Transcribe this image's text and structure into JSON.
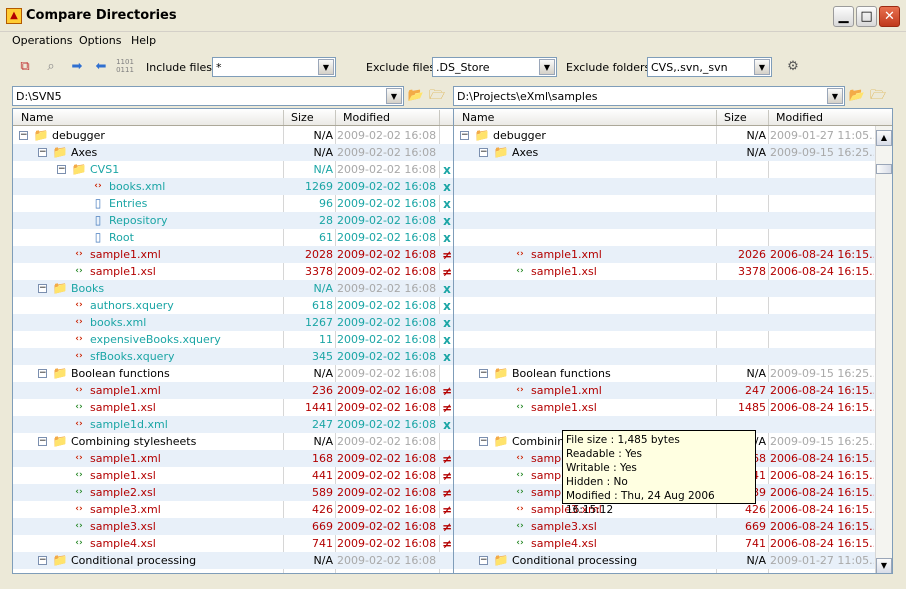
{
  "window": {
    "title": "Compare Directories"
  },
  "menu": [
    {
      "label": "Operations"
    },
    {
      "label": "Options"
    },
    {
      "label": "Help"
    }
  ],
  "toolbar": {
    "include_label": "Include files:",
    "include_value": "*",
    "exclude_files_label": "Exclude files:",
    "exclude_files_value": ".DS_Store",
    "exclude_folders_label": "Exclude folders:",
    "exclude_folders_value": "CVS,.svn,_svn"
  },
  "left_path": "D:\\SVN5",
  "right_path": "D:\\Projects\\eXml\\samples",
  "columns": {
    "name": "Name",
    "size": "Size",
    "modified": "Modified"
  },
  "left_rows": [
    {
      "exp": "−",
      "lvl": 0,
      "icon": "folder",
      "name": "debugger",
      "size": "N/A",
      "mod": "2009-02-02  16:08...",
      "nc": "black",
      "sc": "black",
      "mc": "gray",
      "mark": ""
    },
    {
      "exp": "−",
      "lvl": 1,
      "icon": "folder",
      "name": "Axes",
      "size": "N/A",
      "mod": "2009-02-02  16:08...",
      "nc": "black",
      "sc": "black",
      "mc": "gray",
      "mark": ""
    },
    {
      "exp": "−",
      "lvl": 2,
      "icon": "folder",
      "name": "CVS1",
      "size": "N/A",
      "mod": "2009-02-02  16:08...",
      "nc": "cyan",
      "sc": "cyan",
      "mc": "gray",
      "mark": "x"
    },
    {
      "exp": "",
      "lvl": 3,
      "icon": "xml",
      "name": "books.xml",
      "size": "1269",
      "mod": "2009-02-02  16:08...",
      "nc": "cyan",
      "sc": "cyan",
      "mc": "cyan",
      "mark": "x"
    },
    {
      "exp": "",
      "lvl": 3,
      "icon": "doc",
      "name": "Entries",
      "size": "96",
      "mod": "2009-02-02  16:08...",
      "nc": "cyan",
      "sc": "cyan",
      "mc": "cyan",
      "mark": "x"
    },
    {
      "exp": "",
      "lvl": 3,
      "icon": "doc",
      "name": "Repository",
      "size": "28",
      "mod": "2009-02-02  16:08...",
      "nc": "cyan",
      "sc": "cyan",
      "mc": "cyan",
      "mark": "x"
    },
    {
      "exp": "",
      "lvl": 3,
      "icon": "doc",
      "name": "Root",
      "size": "61",
      "mod": "2009-02-02  16:08...",
      "nc": "cyan",
      "sc": "cyan",
      "mc": "cyan",
      "mark": "x"
    },
    {
      "exp": "",
      "lvl": 2,
      "icon": "xml",
      "name": "sample1.xml",
      "size": "2028",
      "mod": "2009-02-02  16:08...",
      "nc": "red",
      "sc": "red",
      "mc": "red",
      "mark": "≠"
    },
    {
      "exp": "",
      "lvl": 2,
      "icon": "xsl",
      "name": "sample1.xsl",
      "size": "3378",
      "mod": "2009-02-02  16:08...",
      "nc": "red",
      "sc": "red",
      "mc": "red",
      "mark": "≠"
    },
    {
      "exp": "−",
      "lvl": 1,
      "icon": "folder",
      "name": "Books",
      "size": "N/A",
      "mod": "2009-02-02  16:08...",
      "nc": "cyan",
      "sc": "cyan",
      "mc": "gray",
      "mark": "x"
    },
    {
      "exp": "",
      "lvl": 2,
      "icon": "xml",
      "name": "authors.xquery",
      "size": "618",
      "mod": "2009-02-02  16:08...",
      "nc": "cyan",
      "sc": "cyan",
      "mc": "cyan",
      "mark": "x"
    },
    {
      "exp": "",
      "lvl": 2,
      "icon": "xml",
      "name": "books.xml",
      "size": "1267",
      "mod": "2009-02-02  16:08...",
      "nc": "cyan",
      "sc": "cyan",
      "mc": "cyan",
      "mark": "x"
    },
    {
      "exp": "",
      "lvl": 2,
      "icon": "xml",
      "name": "expensiveBooks.xquery",
      "size": "11",
      "mod": "2009-02-02  16:08...",
      "nc": "cyan",
      "sc": "cyan",
      "mc": "cyan",
      "mark": "x"
    },
    {
      "exp": "",
      "lvl": 2,
      "icon": "xml",
      "name": "sfBooks.xquery",
      "size": "345",
      "mod": "2009-02-02  16:08...",
      "nc": "cyan",
      "sc": "cyan",
      "mc": "cyan",
      "mark": "x"
    },
    {
      "exp": "−",
      "lvl": 1,
      "icon": "folder",
      "name": "Boolean functions",
      "size": "N/A",
      "mod": "2009-02-02  16:08...",
      "nc": "black",
      "sc": "black",
      "mc": "gray",
      "mark": ""
    },
    {
      "exp": "",
      "lvl": 2,
      "icon": "xml",
      "name": "sample1.xml",
      "size": "236",
      "mod": "2009-02-02  16:08...",
      "nc": "red",
      "sc": "red",
      "mc": "red",
      "mark": "≠"
    },
    {
      "exp": "",
      "lvl": 2,
      "icon": "xsl",
      "name": "sample1.xsl",
      "size": "1441",
      "mod": "2009-02-02  16:08...",
      "nc": "red",
      "sc": "red",
      "mc": "red",
      "mark": "≠"
    },
    {
      "exp": "",
      "lvl": 2,
      "icon": "xml",
      "name": "sample1d.xml",
      "size": "247",
      "mod": "2009-02-02  16:08...",
      "nc": "cyan",
      "sc": "cyan",
      "mc": "cyan",
      "mark": "x"
    },
    {
      "exp": "−",
      "lvl": 1,
      "icon": "folder",
      "name": "Combining stylesheets",
      "size": "N/A",
      "mod": "2009-02-02  16:08...",
      "nc": "black",
      "sc": "black",
      "mc": "gray",
      "mark": ""
    },
    {
      "exp": "",
      "lvl": 2,
      "icon": "xml",
      "name": "sample1.xml",
      "size": "168",
      "mod": "2009-02-02  16:08...",
      "nc": "red",
      "sc": "red",
      "mc": "red",
      "mark": "≠"
    },
    {
      "exp": "",
      "lvl": 2,
      "icon": "xsl",
      "name": "sample1.xsl",
      "size": "441",
      "mod": "2009-02-02  16:08...",
      "nc": "red",
      "sc": "red",
      "mc": "red",
      "mark": "≠"
    },
    {
      "exp": "",
      "lvl": 2,
      "icon": "xsl",
      "name": "sample2.xsl",
      "size": "589",
      "mod": "2009-02-02  16:08...",
      "nc": "red",
      "sc": "red",
      "mc": "red",
      "mark": "≠"
    },
    {
      "exp": "",
      "lvl": 2,
      "icon": "xml",
      "name": "sample3.xml",
      "size": "426",
      "mod": "2009-02-02  16:08...",
      "nc": "red",
      "sc": "red",
      "mc": "red",
      "mark": "≠"
    },
    {
      "exp": "",
      "lvl": 2,
      "icon": "xsl",
      "name": "sample3.xsl",
      "size": "669",
      "mod": "2009-02-02  16:08...",
      "nc": "red",
      "sc": "red",
      "mc": "red",
      "mark": "≠"
    },
    {
      "exp": "",
      "lvl": 2,
      "icon": "xsl",
      "name": "sample4.xsl",
      "size": "741",
      "mod": "2009-02-02  16:08...",
      "nc": "red",
      "sc": "red",
      "mc": "red",
      "mark": "≠"
    },
    {
      "exp": "−",
      "lvl": 1,
      "icon": "folder",
      "name": "Conditional processing",
      "size": "N/A",
      "mod": "2009-02-02  16:08...",
      "nc": "black",
      "sc": "black",
      "mc": "gray",
      "mark": ""
    }
  ],
  "right_rows": [
    {
      "exp": "−",
      "lvl": 0,
      "icon": "folder",
      "name": "debugger",
      "size": "N/A",
      "mod": "2009-01-27  11:05...",
      "nc": "black",
      "sc": "black",
      "mc": "gray"
    },
    {
      "exp": "−",
      "lvl": 1,
      "icon": "folder",
      "name": "Axes",
      "size": "N/A",
      "mod": "2009-09-15  16:25...",
      "nc": "black",
      "sc": "black",
      "mc": "gray"
    },
    {
      "exp": "",
      "lvl": 0,
      "icon": "",
      "name": "",
      "size": "",
      "mod": "",
      "nc": "black",
      "sc": "black",
      "mc": "gray"
    },
    {
      "exp": "",
      "lvl": 0,
      "icon": "",
      "name": "",
      "size": "",
      "mod": "",
      "nc": "black",
      "sc": "black",
      "mc": "gray"
    },
    {
      "exp": "",
      "lvl": 0,
      "icon": "",
      "name": "",
      "size": "",
      "mod": "",
      "nc": "black",
      "sc": "black",
      "mc": "gray"
    },
    {
      "exp": "",
      "lvl": 0,
      "icon": "",
      "name": "",
      "size": "",
      "mod": "",
      "nc": "black",
      "sc": "black",
      "mc": "gray"
    },
    {
      "exp": "",
      "lvl": 0,
      "icon": "",
      "name": "",
      "size": "",
      "mod": "",
      "nc": "black",
      "sc": "black",
      "mc": "gray"
    },
    {
      "exp": "",
      "lvl": 2,
      "icon": "xml",
      "name": "sample1.xml",
      "size": "2026",
      "mod": "2006-08-24  16:15...",
      "nc": "red",
      "sc": "red",
      "mc": "red"
    },
    {
      "exp": "",
      "lvl": 2,
      "icon": "xsl",
      "name": "sample1.xsl",
      "size": "3378",
      "mod": "2006-08-24  16:15...",
      "nc": "red",
      "sc": "red",
      "mc": "red"
    },
    {
      "exp": "",
      "lvl": 0,
      "icon": "",
      "name": "",
      "size": "",
      "mod": "",
      "nc": "black",
      "sc": "black",
      "mc": "gray"
    },
    {
      "exp": "",
      "lvl": 0,
      "icon": "",
      "name": "",
      "size": "",
      "mod": "",
      "nc": "black",
      "sc": "black",
      "mc": "gray"
    },
    {
      "exp": "",
      "lvl": 0,
      "icon": "",
      "name": "",
      "size": "",
      "mod": "",
      "nc": "black",
      "sc": "black",
      "mc": "gray"
    },
    {
      "exp": "",
      "lvl": 0,
      "icon": "",
      "name": "",
      "size": "",
      "mod": "",
      "nc": "black",
      "sc": "black",
      "mc": "gray"
    },
    {
      "exp": "",
      "lvl": 0,
      "icon": "",
      "name": "",
      "size": "",
      "mod": "",
      "nc": "black",
      "sc": "black",
      "mc": "gray"
    },
    {
      "exp": "−",
      "lvl": 1,
      "icon": "folder",
      "name": "Boolean functions",
      "size": "N/A",
      "mod": "2009-09-15  16:25...",
      "nc": "black",
      "sc": "black",
      "mc": "gray"
    },
    {
      "exp": "",
      "lvl": 2,
      "icon": "xml",
      "name": "sample1.xml",
      "size": "247",
      "mod": "2006-08-24  16:15...",
      "nc": "red",
      "sc": "red",
      "mc": "red"
    },
    {
      "exp": "",
      "lvl": 2,
      "icon": "xsl",
      "name": "sample1.xsl",
      "size": "1485",
      "mod": "2006-08-24  16:15...",
      "nc": "red",
      "sc": "red",
      "mc": "red"
    },
    {
      "exp": "",
      "lvl": 0,
      "icon": "",
      "name": "",
      "size": "",
      "mod": "",
      "nc": "black",
      "sc": "black",
      "mc": "gray"
    },
    {
      "exp": "−",
      "lvl": 1,
      "icon": "folder",
      "name": "Combining",
      "size": "N/A",
      "mod": "2009-09-15  16:25...",
      "nc": "black",
      "sc": "black",
      "mc": "gray"
    },
    {
      "exp": "",
      "lvl": 2,
      "icon": "xml",
      "name": "sample1.xml",
      "size": "168",
      "mod": "2006-08-24  16:15...",
      "nc": "red",
      "sc": "red",
      "mc": "red"
    },
    {
      "exp": "",
      "lvl": 2,
      "icon": "xsl",
      "name": "sample1.xsl",
      "size": "441",
      "mod": "2006-08-24  16:15...",
      "nc": "red",
      "sc": "red",
      "mc": "red"
    },
    {
      "exp": "",
      "lvl": 2,
      "icon": "xsl",
      "name": "sample2.xsl",
      "size": "589",
      "mod": "2006-08-24  16:15...",
      "nc": "red",
      "sc": "red",
      "mc": "red"
    },
    {
      "exp": "",
      "lvl": 2,
      "icon": "xml",
      "name": "sample3.xml",
      "size": "426",
      "mod": "2006-08-24  16:15...",
      "nc": "red",
      "sc": "red",
      "mc": "red"
    },
    {
      "exp": "",
      "lvl": 2,
      "icon": "xsl",
      "name": "sample3.xsl",
      "size": "669",
      "mod": "2006-08-24  16:15...",
      "nc": "red",
      "sc": "red",
      "mc": "red"
    },
    {
      "exp": "",
      "lvl": 2,
      "icon": "xsl",
      "name": "sample4.xsl",
      "size": "741",
      "mod": "2006-08-24  16:15...",
      "nc": "red",
      "sc": "red",
      "mc": "red"
    },
    {
      "exp": "−",
      "lvl": 1,
      "icon": "folder",
      "name": "Conditional processing",
      "size": "N/A",
      "mod": "2009-01-27  11:05...",
      "nc": "black",
      "sc": "black",
      "mc": "gray"
    }
  ],
  "tooltip": {
    "lines": [
      "File size : 1,485 bytes",
      "Readable : Yes",
      "Writable : Yes",
      "Hidden : No",
      "Modified : Thu, 24 Aug 2006 16:15:12"
    ]
  }
}
